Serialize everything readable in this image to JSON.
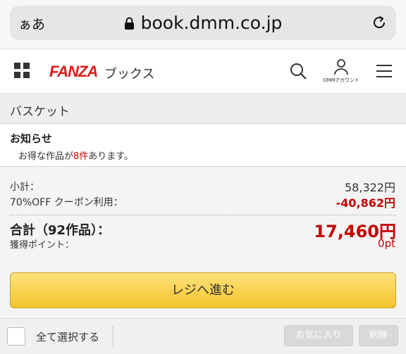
{
  "browser": {
    "aa_label": "ぁあ",
    "url": "book.dmm.co.jp",
    "lock_icon": "lock-icon",
    "reload_icon": "reload-icon"
  },
  "header": {
    "logo": "FANZA",
    "logo_sub": "ブックス",
    "account_label": "DMMアカウント",
    "icons": [
      "grid-icon",
      "search-icon",
      "account-icon",
      "menu-icon"
    ]
  },
  "basket": {
    "title": "バスケット"
  },
  "notice": {
    "title": "お知らせ",
    "text_before": "お得な作品が",
    "highlight": "8件",
    "text_after": "あります。"
  },
  "totals": {
    "subtotal_label": "小計：",
    "subtotal_value": "58,322円",
    "coupon_label": "70%OFF クーポン利用：",
    "coupon_value": "-40,862円",
    "total_label": "合計（92作品）：",
    "total_value": "17,460円",
    "points_label": "獲得ポイント：",
    "points_value": "0pt",
    "checkout_label": "レジへ進む"
  },
  "footer": {
    "select_all_label": "全て選択する",
    "favorite_label": "お気に入り",
    "delete_label": "削除"
  },
  "colors": {
    "brand_red": "#e01a1a",
    "price_red": "#c40000",
    "checkout_yellow": "#f5c42e"
  }
}
